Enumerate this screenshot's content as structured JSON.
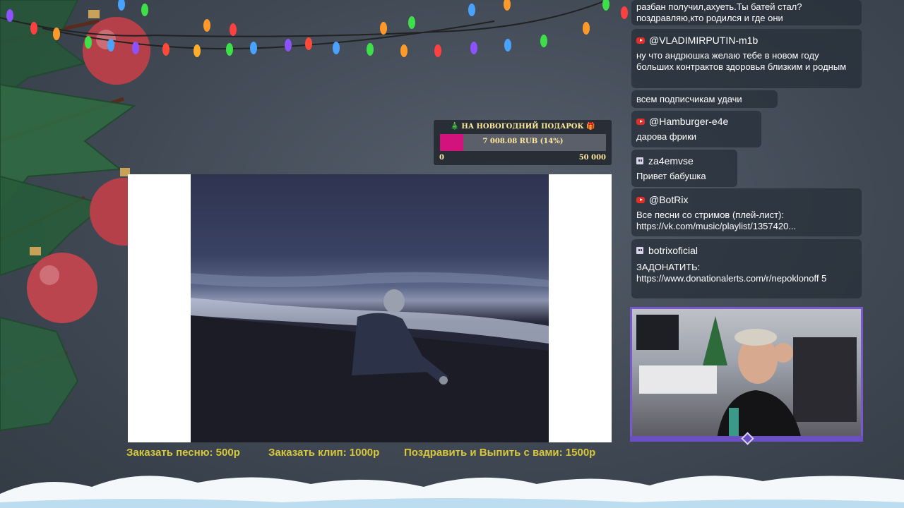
{
  "goal": {
    "title": "🎄 НА НОВОГОДНИЙ ПОДАРОК 🎁",
    "amount": "7 008.08 RUB (14%)",
    "min": "0",
    "max": "50 000",
    "progress": 0.14,
    "fill_color": "#d3137d"
  },
  "prices": {
    "song": "Заказать песню: 500р",
    "clip": "Заказать клип: 1000р",
    "congrats": "Поздравить и Выпить с вами: 1500р",
    "color": "#d8c83a"
  },
  "chat": {
    "messages": [
      {
        "platform": "youtube",
        "user": "",
        "text": "разбан получил,ахуеть.Ты батей стал? поздравляю,кто родился и где они"
      },
      {
        "platform": "youtube",
        "user": "@VLADIMIRPUTIN-m1b",
        "text": "ну что андрюшка желаю тебе в новом году больших контрактов здоровья близким и родным"
      },
      {
        "platform": "youtube",
        "user": "",
        "text": "всем подписчикам удачи"
      },
      {
        "platform": "youtube",
        "user": "@Hamburger-e4e",
        "text": "дарова фрики"
      },
      {
        "platform": "twitch",
        "user": "za4emvse",
        "text": "Привет бабушка"
      },
      {
        "platform": "youtube",
        "user": "@BotRix",
        "text": "Все песни со стримов (плей-лист): https://vk.com/music/playlist/1357420..."
      },
      {
        "platform": "twitch",
        "user": "botrixoficial",
        "text": "ЗАДОНАТИТЬ: https://www.donationalerts.com/r/nepoklonoff 5"
      }
    ]
  },
  "icons": {
    "youtube": "youtube-icon",
    "twitch": "twitch-icon"
  },
  "colors": {
    "background": "#3f4853",
    "chat_bubble": "#262e37",
    "webcam_border": "#7a5acb"
  }
}
